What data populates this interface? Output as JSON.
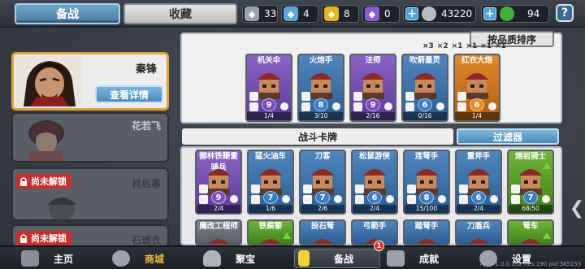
{
  "tabs": {
    "prep": "备战",
    "collection": "收藏"
  },
  "resources": [
    {
      "icon": "silver-shard-icon",
      "value": "33",
      "color": "#9aa3ad"
    },
    {
      "icon": "blue-shard-icon",
      "value": "4",
      "color": "#5aa5dd"
    },
    {
      "icon": "gold-shard-icon",
      "value": "8",
      "color": "#e5b523"
    },
    {
      "icon": "purple-shard-icon",
      "value": "0",
      "color": "#8b5cd0"
    },
    {
      "icon": "silver-coin-icon",
      "value": "43220",
      "color": "#b8bdc3"
    },
    {
      "icon": "green-gem-icon",
      "value": "94",
      "color": "#43b03c"
    }
  ],
  "help": "?",
  "heroes": {
    "selected": {
      "name": "秦锋",
      "detail_label": "查看详情"
    },
    "list": [
      {
        "name": "花若飞",
        "locked": false
      },
      {
        "name": "肖启事",
        "locked": true,
        "lock_label": "尚未解锁"
      },
      {
        "name": "石琥衣",
        "locked": true,
        "lock_label": "尚未解锁"
      }
    ]
  },
  "sort_label": "按品质排序",
  "multipliers": [
    "×3",
    "×2",
    "×1",
    "×1",
    "×1",
    "×1",
    "×1",
    "×1"
  ],
  "deck": [
    {
      "name": "机关伞",
      "cost": "9",
      "count": "1/4",
      "rarity": "purple"
    },
    {
      "name": "火炮手",
      "cost": "8",
      "count": "3/10",
      "rarity": "blue"
    },
    {
      "name": "法师",
      "cost": "9",
      "count": "2/16",
      "rarity": "purple"
    },
    {
      "name": "吹箭墨灵",
      "cost": "6",
      "count": "0/16",
      "rarity": "blue"
    },
    {
      "name": "红衣大炮",
      "cost": "6",
      "count": "1/4",
      "rarity": "orange"
    }
  ],
  "section_title": "战斗卡牌",
  "filter_label": "过滤器",
  "cards_row1": [
    {
      "name": "御林铁鞭重骑兵",
      "cost": "9",
      "count": "2/4",
      "rarity": "purple",
      "up": false
    },
    {
      "name": "猛火油车",
      "cost": "7",
      "count": "1/6",
      "rarity": "blue",
      "up": false
    },
    {
      "name": "刀客",
      "cost": "7",
      "count": "2/6",
      "rarity": "blue",
      "up": false
    },
    {
      "name": "松鼠游侠",
      "cost": "6",
      "count": "2/4",
      "rarity": "blue",
      "up": false
    },
    {
      "name": "连弩手",
      "cost": "8",
      "count": "15/100",
      "rarity": "blue",
      "up": false
    },
    {
      "name": "重斧手",
      "cost": "6",
      "count": "2/4",
      "rarity": "blue",
      "up": false
    },
    {
      "name": "熔岩骑士",
      "cost": "7",
      "count": "68/50",
      "rarity": "green",
      "up": true
    }
  ],
  "cards_row2": [
    {
      "name": "魔改工程师",
      "rarity": "gray",
      "up": false
    },
    {
      "name": "铁蒺藜",
      "rarity": "green",
      "up": true
    },
    {
      "name": "投石弩",
      "rarity": "blue",
      "up": false
    },
    {
      "name": "弓箭手",
      "rarity": "blue",
      "up": false
    },
    {
      "name": "踏弩手",
      "rarity": "blue",
      "up": false
    },
    {
      "name": "刀盾兵",
      "rarity": "blue",
      "up": false
    },
    {
      "name": "弩车",
      "rarity": "green",
      "up": true
    }
  ],
  "nav": [
    {
      "id": "home",
      "label": "主页",
      "icon": "castle-icon"
    },
    {
      "id": "shop",
      "label": "商城",
      "icon": "coin-stack-icon"
    },
    {
      "id": "treasure",
      "label": "聚宝",
      "icon": "treasure-bowl-icon"
    },
    {
      "id": "prep",
      "label": "备战",
      "icon": "card-icon",
      "badge": "1"
    },
    {
      "id": "achievements",
      "label": "成就",
      "icon": "achievement-icon"
    },
    {
      "id": "settings",
      "label": "设置",
      "icon": "gear-icon"
    }
  ],
  "version": "App: 1.0.0.152 Res:190 pid:365153"
}
